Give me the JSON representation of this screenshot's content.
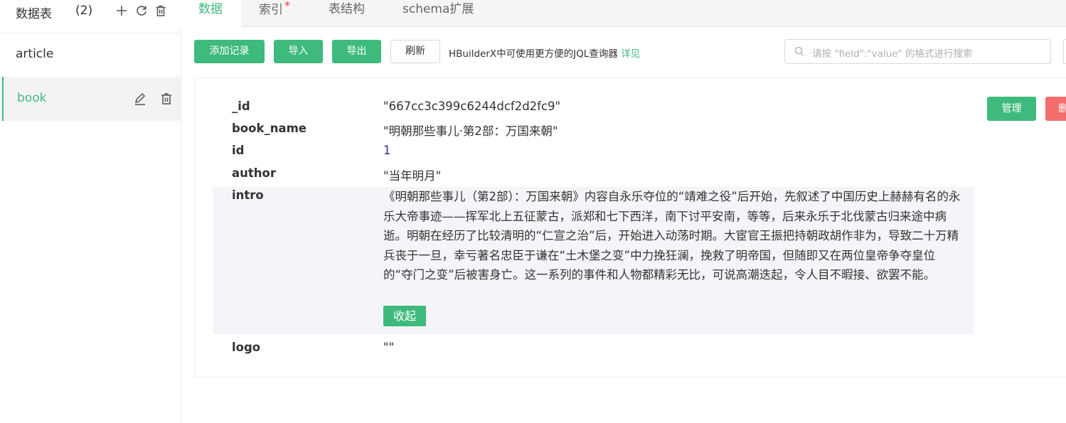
{
  "sidebar": {
    "title": "数据表",
    "count": "(2)",
    "items": [
      {
        "label": "article"
      },
      {
        "label": "book"
      }
    ]
  },
  "tabs": [
    {
      "label": "数据"
    },
    {
      "label": "索引",
      "star": "*"
    },
    {
      "label": "表结构"
    },
    {
      "label": "schema扩展"
    }
  ],
  "toolbar": {
    "add_label": "添加记录",
    "import_label": "导入",
    "export_label": "导出",
    "refresh_label": "刷新",
    "hint": "HBuilderX中可使用更方便的JQL查询器",
    "hint_link": "详见",
    "search_placeholder": "请按 \"field\":\"value\" 的格式进行搜索"
  },
  "record": {
    "manage_label": "管理",
    "delete_label": "删除",
    "fields": [
      {
        "key": "_id",
        "value": "\"667cc3c399c6244dcf2d2fc9\""
      },
      {
        "key": "book_name",
        "value": "\"明朝那些事儿·第2部：万国来朝\""
      },
      {
        "key": "id",
        "value": "1"
      },
      {
        "key": "author",
        "value": "\"当年明月\""
      },
      {
        "key": "intro",
        "value": "《明朝那些事儿（第2部）：万国来朝》内容自永乐夺位的“靖难之役”后开始，先叙述了中国历史上赫赫有名的永乐大帝事迹——挥军北上五征蒙古，派郑和七下西洋，南下讨平安南，等等，后来永乐于北伐蒙古归来途中病逝。明朝在经历了比较清明的“仁宣之治”后，开始进入动荡时期。大宦官王振把持朝政胡作非为，导致二十万精兵丧于一旦，幸亏著名忠臣于谦在“土木堡之变”中力挽狂澜，挽救了明帝国，但随即又在两位皇帝争夺皇位的“夺门之变”后被害身亡。这一系列的事件和人物都精彩无比，可说高潮迭起，令人目不暇接、欲罢不能。"
      },
      {
        "key": "logo",
        "value": "\"\""
      }
    ],
    "collapse_label": "收起"
  },
  "colors": {
    "accent": "#3fba7d",
    "danger": "#f36d6d",
    "number": "#2a2aa8"
  }
}
